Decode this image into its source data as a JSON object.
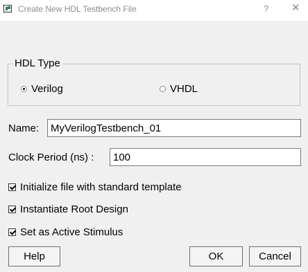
{
  "window": {
    "title": "Create New HDL Testbench File",
    "help_glyph": "?",
    "close_glyph": "✕"
  },
  "hdl_type": {
    "legend": "HDL Type",
    "options": [
      {
        "label": "Verilog",
        "selected": true
      },
      {
        "label": "VHDL",
        "selected": false
      }
    ]
  },
  "name": {
    "label": "Name:",
    "value": "MyVerilogTestbench_01"
  },
  "clock": {
    "label": "Clock Period (ns) :",
    "value": "100"
  },
  "options": [
    {
      "label": "Initialize file with standard template",
      "checked": true
    },
    {
      "label": "Instantiate Root Design",
      "checked": true
    },
    {
      "label": "Set as Active Stimulus",
      "checked": true
    }
  ],
  "buttons": {
    "help": "Help",
    "ok": "OK",
    "cancel": "Cancel"
  }
}
